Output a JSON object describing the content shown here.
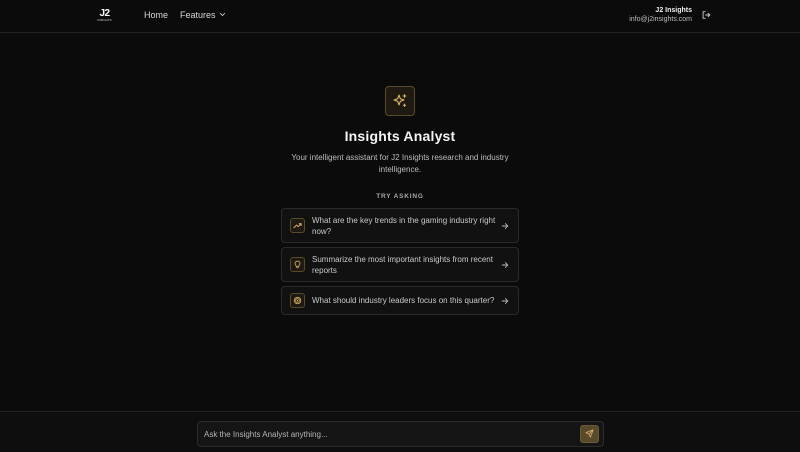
{
  "header": {
    "logo": {
      "mark": "J2",
      "sub": "INSIGHTS"
    },
    "nav": {
      "home": "Home",
      "features": "Features"
    },
    "account": {
      "name": "J2 Insights",
      "email": "info@j2insights.com"
    }
  },
  "hero": {
    "icon": "sparkles-icon",
    "title": "Insights Analyst",
    "subtitle": "Your intelligent assistant for J2 Insights research and industry intelligence."
  },
  "suggestions": {
    "label": "TRY ASKING",
    "items": [
      {
        "icon": "trending-up-icon",
        "text": "What are the key trends in the gaming industry right now?"
      },
      {
        "icon": "lightbulb-icon",
        "text": "Summarize the most important insights from recent reports"
      },
      {
        "icon": "target-icon",
        "text": "What should industry leaders focus on this quarter?"
      }
    ]
  },
  "chat": {
    "placeholder": "Ask the Insights Analyst anything...",
    "send_icon": "send-icon"
  },
  "colors": {
    "background": "#0b0b0b",
    "accent": "#c9a35a",
    "accent_bg": "#1e1a12"
  }
}
